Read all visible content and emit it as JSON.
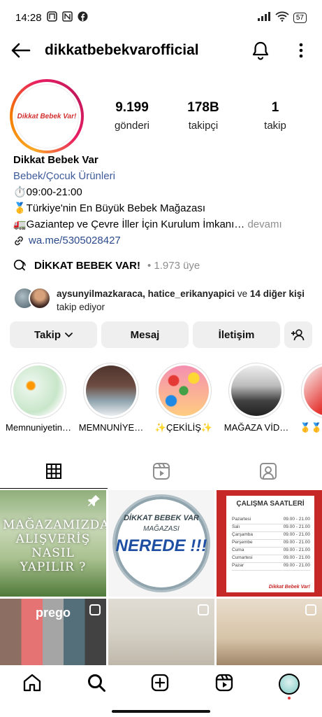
{
  "status": {
    "time": "14:28",
    "battery": "57"
  },
  "header": {
    "username": "dikkatbebekvarofficial"
  },
  "profile": {
    "avatar_text": "Dikkat Bebek Var!",
    "stats": [
      {
        "num": "9.199",
        "label": "gönderi"
      },
      {
        "num": "178B",
        "label": "takipçi"
      },
      {
        "num": "1",
        "label": "takip"
      }
    ]
  },
  "bio": {
    "name": "Dikkat Bebek Var",
    "category": "Bebek/Çocuk Ürünleri",
    "line1": "⏱️09:00-21:00",
    "line2": "🥇Türkiye'nin En Büyük Bebek Mağazası",
    "line3": "🚛Gaziantep ve Çevre İller İçin Kurulum İmkanı…",
    "more": " devamı",
    "link": "wa.me/5305028427"
  },
  "community": {
    "name": "DİKKAT BEBEK VAR!",
    "members": "• 1.973 üye"
  },
  "followed_by": {
    "users": "aysunyilmazkaraca, hatice_erikanyapici",
    "connector": " ve ",
    "others": "14 diğer kişi",
    "suffix": "takip ediyor"
  },
  "actions": {
    "follow": "Takip",
    "message": "Mesaj",
    "contact": "İletişim"
  },
  "highlights": [
    {
      "label": "Memnuniyetin…"
    },
    {
      "label": "MEMNUNİYE…"
    },
    {
      "label": "✨ÇEKİLİŞ✨"
    },
    {
      "label": "MAĞAZA VİD…"
    },
    {
      "label": "🥇🥇M"
    }
  ],
  "posts": {
    "post1": {
      "text": "MAĞAZAMIZDA ALIŞVERİŞ NASIL YAPILIR ?"
    },
    "post2": {
      "line1": "DİKKAT BEBEK VAR",
      "line2": "MAĞAZASI",
      "line3": "NEREDE !!!"
    },
    "post3": {
      "title": "ÇALIŞMA SAATLERİ",
      "days": [
        {
          "day": "Pazartesi",
          "hours": "09.00 - 21.00"
        },
        {
          "day": "Salı",
          "hours": "09.00 - 21.00"
        },
        {
          "day": "Çarşamba",
          "hours": "09.00 - 21.00"
        },
        {
          "day": "Perşembe",
          "hours": "09.00 - 21.00"
        },
        {
          "day": "Cuma",
          "hours": "09.00 - 21.00"
        },
        {
          "day": "Cumartesi",
          "hours": "09.00 - 21.00"
        },
        {
          "day": "Pazar",
          "hours": "09.00 - 21.00"
        }
      ],
      "brand": "Dikkat Bebek Var!"
    },
    "post4": {
      "brand": "prego"
    }
  },
  "colors": {
    "accent_link": "#2b4a8b",
    "category": "#3f5b99",
    "red_post": "#c62828"
  }
}
